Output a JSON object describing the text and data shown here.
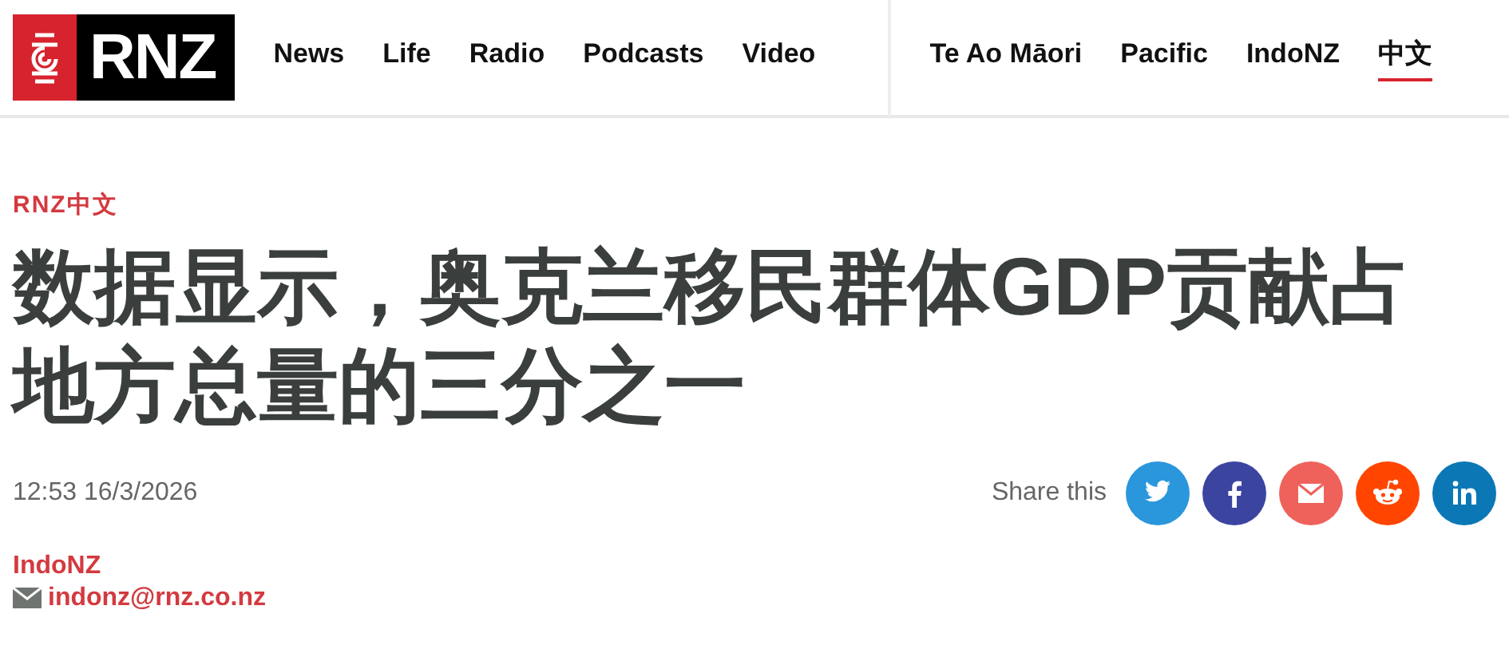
{
  "logo": {
    "text": "RNZ"
  },
  "nav": {
    "main": [
      {
        "label": "News"
      },
      {
        "label": "Life"
      },
      {
        "label": "Radio"
      },
      {
        "label": "Podcasts"
      },
      {
        "label": "Video"
      }
    ],
    "secondary": [
      {
        "label": "Te Ao Māori",
        "selected": false
      },
      {
        "label": "Pacific",
        "selected": false
      },
      {
        "label": "IndoNZ",
        "selected": false
      },
      {
        "label": "中文",
        "selected": true
      }
    ]
  },
  "article": {
    "section": "RNZ中文",
    "headline": "数据显示，奥克兰移民群体GDP贡献占地方总量的三分之一",
    "timestamp": "12:53 16/3/2026",
    "share_label": "Share this",
    "share": [
      {
        "kind": "twitter",
        "color": "#2a96dc"
      },
      {
        "kind": "facebook",
        "color": "#3b45a0"
      },
      {
        "kind": "email",
        "color": "#ef625c"
      },
      {
        "kind": "reddit",
        "color": "#ff4500"
      },
      {
        "kind": "linkedin",
        "color": "#0b78b5"
      }
    ],
    "author": "IndoNZ",
    "email": "indonz@rnz.co.nz"
  }
}
